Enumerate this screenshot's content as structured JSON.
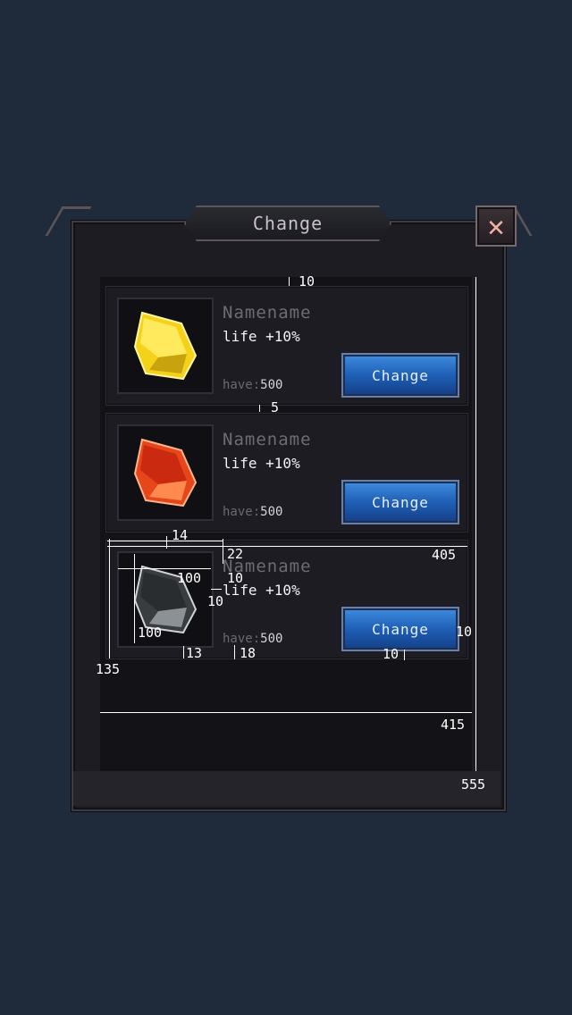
{
  "dialog": {
    "title": "Change",
    "close_label": "✕"
  },
  "items": [
    {
      "name": "Namename",
      "desc": "life +10%",
      "have_label": "have:",
      "have_value": "500",
      "button": "Change",
      "gem": "yellow-gem-icon",
      "gem_color": "#f5d21a"
    },
    {
      "name": "Namename",
      "desc": "life +10%",
      "have_label": "have:",
      "have_value": "500",
      "button": "Change",
      "gem": "red-gem-icon",
      "gem_color": "#e7461b"
    },
    {
      "name": "Namename",
      "desc": "life +10%",
      "have_label": "have:",
      "have_value": "500",
      "button": "Change",
      "gem": "black-gem-icon",
      "gem_color": "#3a3d40"
    }
  ],
  "spec_annotations": [
    "10",
    "5",
    "14",
    "22",
    "405",
    "100",
    "10",
    "10",
    "100",
    "13",
    "18",
    "10",
    "10",
    "135",
    "415",
    "555"
  ],
  "colors": {
    "background": "#1f2a3a",
    "button_blue": "#1f5fb6",
    "close_accent": "#f0b1a3"
  }
}
